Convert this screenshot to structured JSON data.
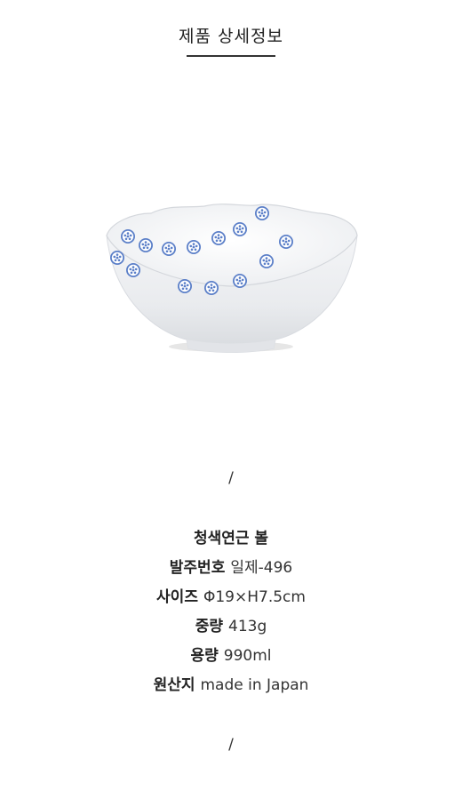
{
  "header": {
    "title": "제품 상세정보"
  },
  "product_image": {
    "name": "bowl-with-lotus-root-pattern",
    "pattern_color": "#5b7fc8"
  },
  "divider_top": "/",
  "divider_bottom": "/",
  "details": {
    "product_name": "청색연근 볼",
    "rows": [
      {
        "key": "발주번호",
        "value": "일제-496"
      },
      {
        "key": "사이즈",
        "value": "Φ19×H7.5cm"
      },
      {
        "key": "중량",
        "value": "413g"
      },
      {
        "key": "용량",
        "value": "990ml"
      },
      {
        "key": "원산지",
        "value": "made in Japan"
      }
    ]
  }
}
